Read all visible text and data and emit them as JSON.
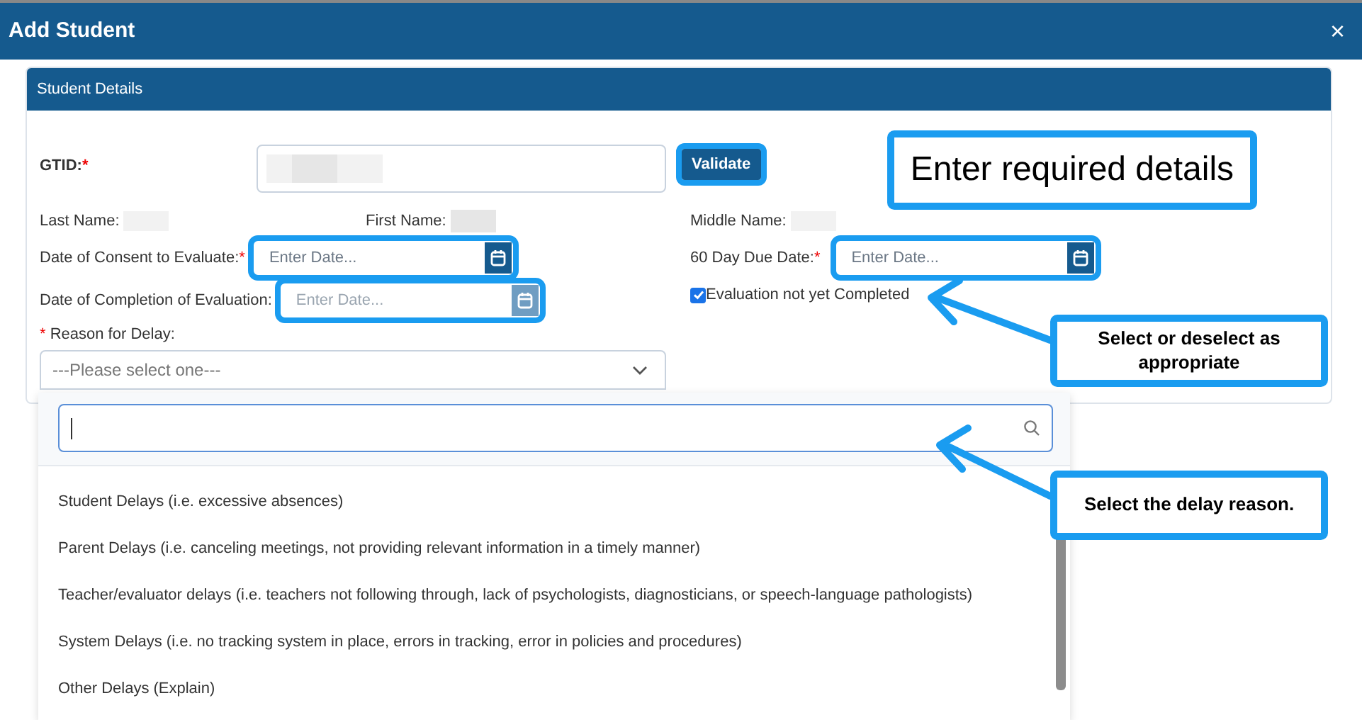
{
  "dialog": {
    "title": "Add Student",
    "close": "×"
  },
  "section": {
    "title": "Student Details"
  },
  "gtid": {
    "label": "GTID:",
    "required_mark": "*",
    "button": "Validate",
    "button_highlighted": true
  },
  "names": [
    {
      "label": "Last Name:"
    },
    {
      "label": "First Name:"
    },
    {
      "label": "Middle Name:"
    }
  ],
  "date_fields": [
    {
      "label": "Date of Consent to Evaluate:",
      "required_mark": "*",
      "placeholder": "Enter Date...",
      "disabled": false,
      "highlighted": true
    },
    {
      "label": "60 Day Due Date:",
      "required_mark": "*",
      "placeholder": "Enter Date...",
      "disabled": false,
      "highlighted": true
    },
    {
      "label": "Date of Completion of Evaluation:",
      "placeholder": "Enter Date...",
      "disabled": true,
      "highlighted": true
    }
  ],
  "evaluation_checkbox": {
    "label": "Evaluation not yet Completed",
    "checked": true
  },
  "reason": {
    "label": "Reason for Delay:",
    "required_mark": "*",
    "placeholder": "---Please select one---",
    "expanded": true
  },
  "dropdown": {
    "options": [
      {
        "label": "Student Delays (i.e. excessive absences)"
      },
      {
        "label": "Parent Delays (i.e. canceling meetings, not providing relevant information in a timely manner)"
      },
      {
        "label": "Teacher/evaluator delays (i.e. teachers not following through, lack of psychologists, diagnosticians, or speech-language pathologists)"
      },
      {
        "label": "System Delays (i.e. no tracking system in place, errors in tracking, error in policies and procedures)"
      },
      {
        "label": "Other Delays (Explain)"
      }
    ]
  },
  "callouts": [
    {
      "text": "Enter required details",
      "kind": "large"
    },
    {
      "text": "Select or deselect as appropriate",
      "kind": "arrow"
    },
    {
      "text": "Select the delay reason.",
      "kind": "arrow"
    }
  ]
}
